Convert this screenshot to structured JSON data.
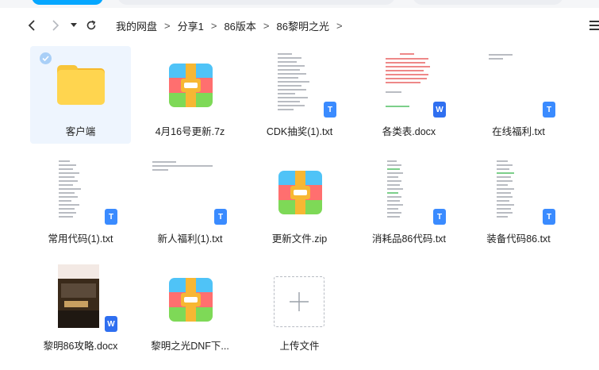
{
  "nav": {
    "back_icon": "chevron-left-icon",
    "forward_icon": "chevron-right-icon",
    "history_icon": "caret-down-icon",
    "refresh_icon": "refresh-icon"
  },
  "breadcrumb": [
    "我的网盘",
    "分享1",
    "86版本",
    "86黎明之光"
  ],
  "breadcrumb_separator": ">",
  "files": [
    {
      "name": "客户端",
      "type": "folder",
      "selected": true
    },
    {
      "name": "4月16号更新.7z",
      "type": "archive"
    },
    {
      "name": "CDK抽奖(1).txt",
      "type": "txt"
    },
    {
      "name": "各类表.docx",
      "type": "docx"
    },
    {
      "name": "在线福利.txt",
      "type": "txt"
    },
    {
      "name": "常用代码(1).txt",
      "type": "txt"
    },
    {
      "name": "新人福利(1).txt",
      "type": "txt"
    },
    {
      "name": "更新文件.zip",
      "type": "archive"
    },
    {
      "name": "消耗品86代码.txt",
      "type": "txt"
    },
    {
      "name": "装备代码86.txt",
      "type": "txt"
    },
    {
      "name": "黎明86攻略.docx",
      "type": "docx"
    },
    {
      "name": "黎明之光DNF下...",
      "type": "archive"
    },
    {
      "name": "上传文件",
      "type": "upload"
    }
  ],
  "badges": {
    "txt": "T",
    "docx": "W"
  },
  "colors": {
    "accent": "#06a7ff",
    "selected_bg": "#eef5fe",
    "txt_badge": "#3a8bff",
    "doc_badge": "#2f6ff0"
  }
}
